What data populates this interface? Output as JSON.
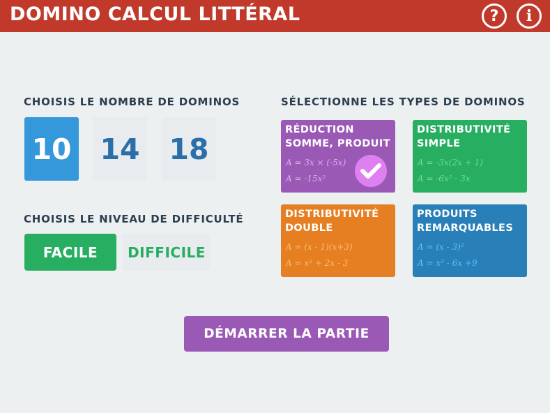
{
  "header": {
    "title": "DOMINO CALCUL LITTÉRAL",
    "help_icon": "?",
    "info_icon": "i",
    "color": "#c0392b"
  },
  "count_section": {
    "label": "CHOISIS LE NOMBRE DE DOMINOS",
    "options": [
      "10",
      "14",
      "18"
    ],
    "selected": "10"
  },
  "level_section": {
    "label": "CHOISIS LE NIVEAU DE DIFFICULTÉ",
    "options": [
      "FACILE",
      "DIFFICILE"
    ],
    "selected": "FACILE"
  },
  "types_section": {
    "label": "SÉLECTIONNE LES TYPES DE DOMINOS",
    "cards": [
      {
        "title_line1": "RÉDUCTION",
        "title_line2": "SOMME, PRODUIT",
        "formula1": "A = 3x × (-5x)",
        "formula2": "A = -15x²",
        "selected": true,
        "color": "#9b59b6"
      },
      {
        "title_line1": "DISTRIBUTIVITÉ",
        "title_line2": "SIMPLE",
        "formula1": "A = -3x(2x + 1)",
        "formula2": "A = -6x² - 3x",
        "selected": false,
        "color": "#27ae60"
      },
      {
        "title_line1": "DISTRIBUTIVITÉ",
        "title_line2": "DOUBLE",
        "formula1": "A = (x - 1)(x+3)",
        "formula2": "A = x² + 2x - 3",
        "selected": false,
        "color": "#e67e22"
      },
      {
        "title_line1": "PRODUITS",
        "title_line2": "REMARQUABLES",
        "formula1": "A = (x - 3)²",
        "formula2": "A = x² - 6x +9",
        "selected": false,
        "color": "#2980b9"
      }
    ]
  },
  "start_button": {
    "label": "DÉMARRER LA PARTIE"
  }
}
